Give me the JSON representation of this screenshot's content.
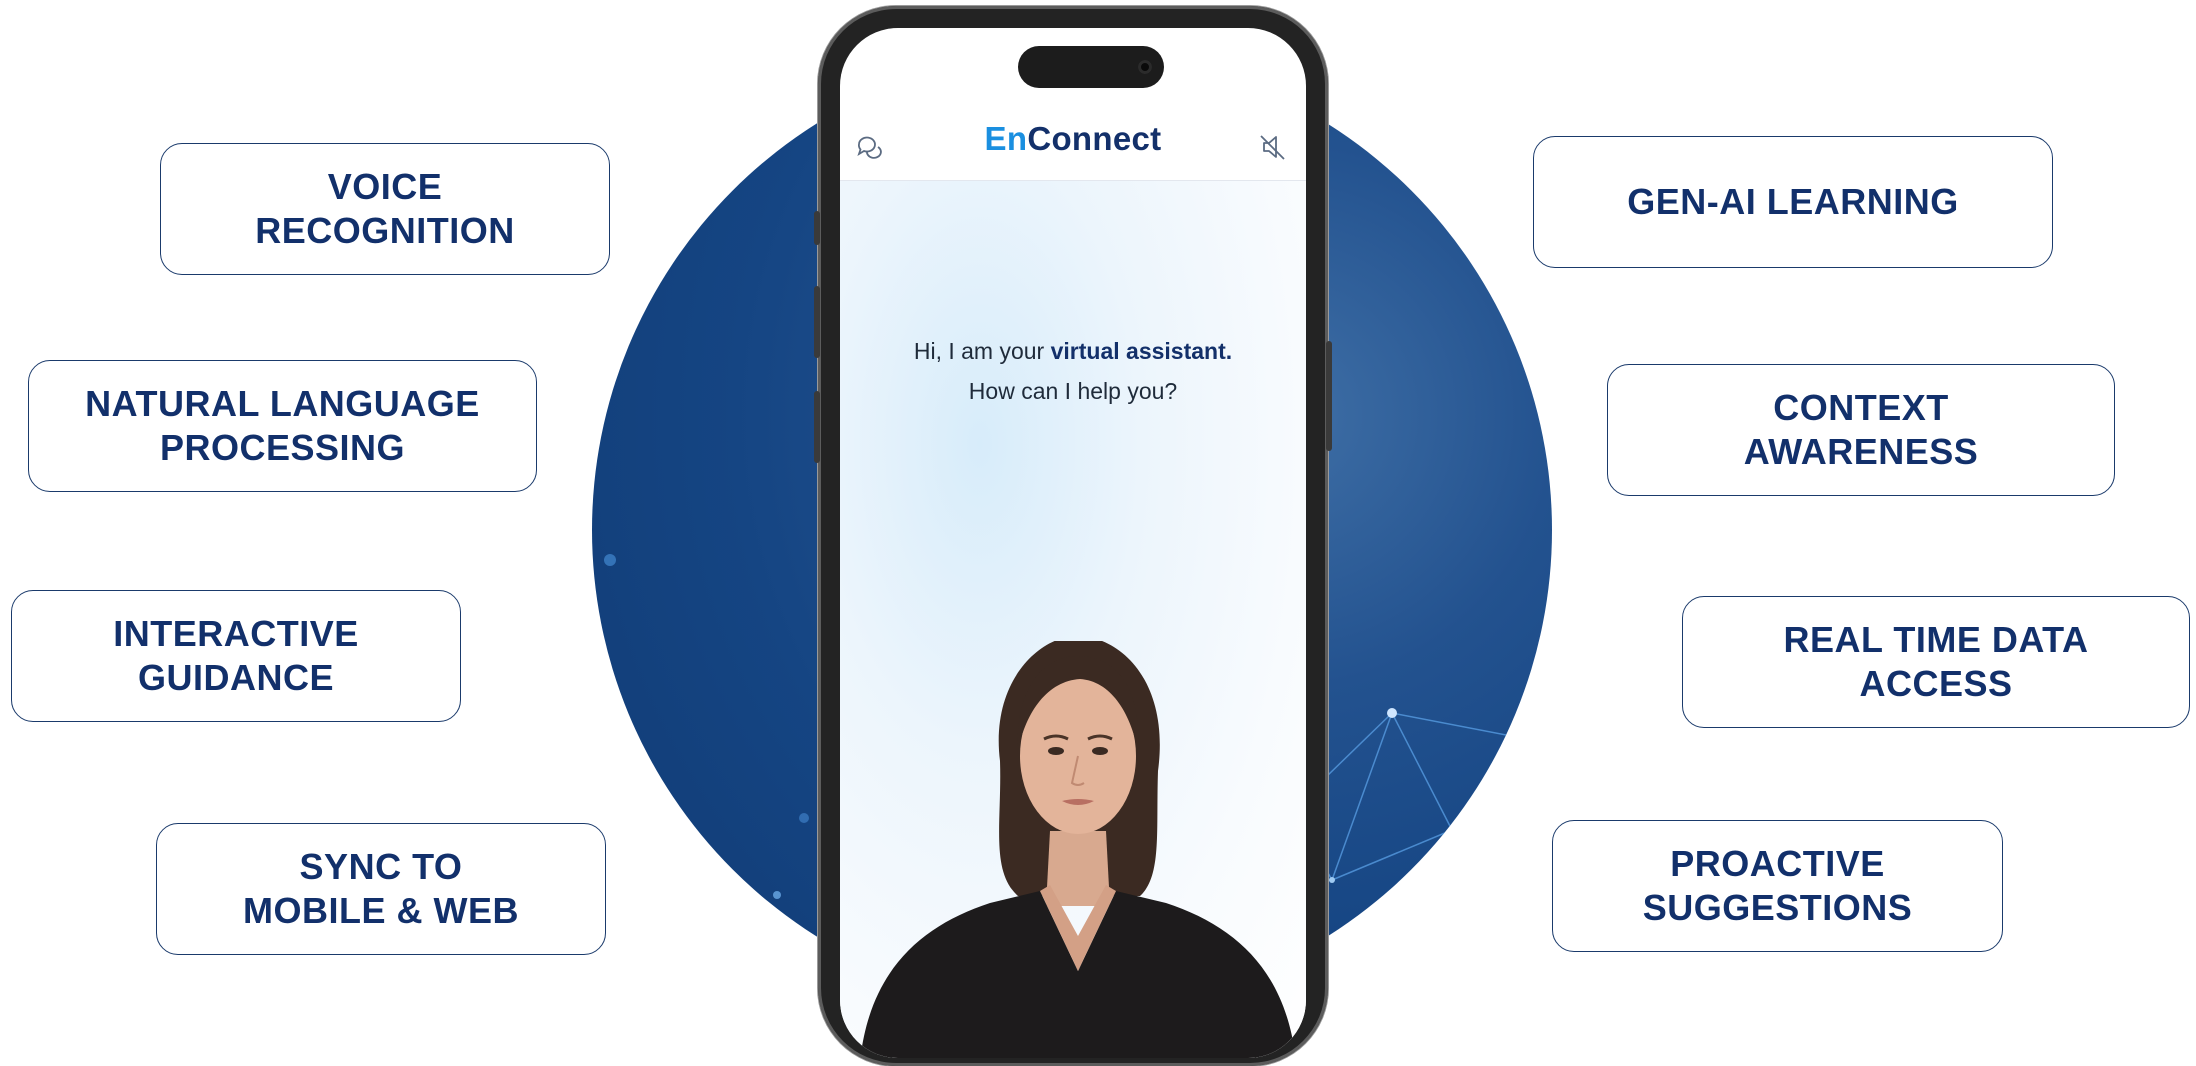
{
  "app": {
    "logo_part1": "En",
    "logo_part2": "Connect",
    "greeting_prefix": "Hi, I am your ",
    "greeting_bold": "virtual assistant.",
    "greeting_line2": "How can I help you?",
    "icons": [
      "chat-bubbles-icon",
      "speaker-muted-icon"
    ]
  },
  "features_left": [
    "VOICE\nRECOGNITION",
    "NATURAL LANGUAGE\nPROCESSING",
    "INTERACTIVE\nGUIDANCE",
    "SYNC TO\nMOBILE & WEB"
  ],
  "features_right": [
    "GEN-AI LEARNING",
    "CONTEXT\nAWARENESS",
    "REAL TIME DATA\nACCESS",
    "PROACTIVE\nSUGGESTIONS"
  ],
  "colors": {
    "brand_navy": "#12306b",
    "brand_light_blue": "#1a8fe0",
    "circle_blue": "#154583"
  }
}
